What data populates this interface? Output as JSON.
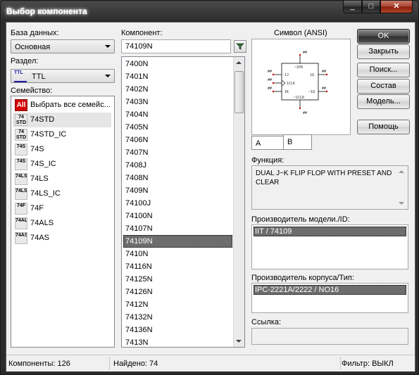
{
  "window": {
    "title": "Выбор компонента",
    "close_glyph": "✕",
    "min_glyph": "_",
    "max_glyph": "□"
  },
  "database": {
    "label": "База данных:",
    "value": "Основная"
  },
  "section": {
    "label": "Раздел:",
    "value": "TTL",
    "icon_text": "TTL"
  },
  "family": {
    "label": "Семейство:",
    "items": [
      {
        "icon": "All",
        "label": "Выбрать все семейс..."
      },
      {
        "icon": "74\nSTD",
        "label": "74STD"
      },
      {
        "icon": "74\nSTD",
        "label": "74STD_IC"
      },
      {
        "icon": "74S",
        "label": "74S"
      },
      {
        "icon": "74S",
        "label": "74S_IC"
      },
      {
        "icon": "74LS",
        "label": "74LS"
      },
      {
        "icon": "74LS",
        "label": "74LS_IC"
      },
      {
        "icon": "74F",
        "label": "74F"
      },
      {
        "icon": "74ALS",
        "label": "74ALS"
      },
      {
        "icon": "74AS",
        "label": "74AS"
      }
    ]
  },
  "component": {
    "label": "Компонент:",
    "value": "74109N",
    "items": [
      "7400N",
      "7401N",
      "7402N",
      "7403N",
      "7404N",
      "7405N",
      "7406N",
      "7407N",
      "7408J",
      "7408N",
      "7409N",
      "74100J",
      "74100N",
      "74107N",
      "74109N",
      "7410N",
      "74116N",
      "74125N",
      "74126N",
      "7412N",
      "74132N",
      "74136N",
      "7413N"
    ]
  },
  "symbol": {
    "label": "Символ (ANSI)",
    "tabs": [
      "A",
      "B"
    ],
    "pins": {
      "top": "~1PR",
      "j": "1J",
      "clk": "1CLK",
      "k": "1K",
      "q": "1Q",
      "nq": "~1Q",
      "bottom": "~1CLR",
      "hash": "##"
    }
  },
  "buttons": {
    "ok": "OK",
    "close": "Закрыть",
    "search": "Поиск...",
    "detail": "Состав",
    "model": "Модель...",
    "help": "Помощь"
  },
  "function": {
    "label": "Функция:",
    "text": "DUAL J~K FLIP FLOP WITH PRESET AND CLEAR"
  },
  "model_maker": {
    "label": "Производитель модели./ID:",
    "value": "IIT / 74109"
  },
  "footprint": {
    "label": "Производитель корпуса/Тип:",
    "value": "IPC-2221A/2222 / NO16"
  },
  "link": {
    "label": "Ссылка:",
    "value": ""
  },
  "status": {
    "components": "Компоненты: 126",
    "found": "Найдено: 74",
    "filter": "Фильтр: ВЫКЛ"
  }
}
